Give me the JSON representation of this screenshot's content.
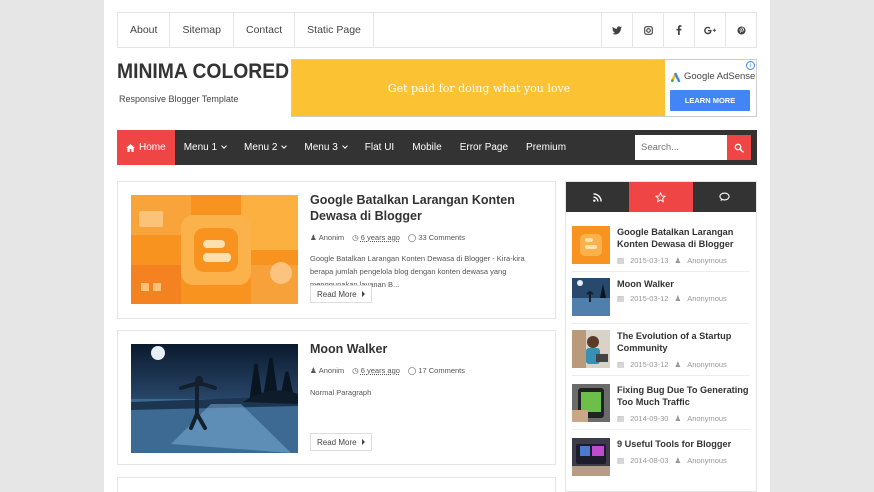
{
  "top_nav": [
    "About",
    "Sitemap",
    "Contact",
    "Static Page"
  ],
  "social": [
    {
      "name": "twitter-icon",
      "glyph": "t"
    },
    {
      "name": "instagram-icon",
      "glyph": "◘"
    },
    {
      "name": "facebook-icon",
      "glyph": "f"
    },
    {
      "name": "google-plus-icon",
      "glyph": "g+"
    },
    {
      "name": "pinterest-icon",
      "glyph": "℗"
    }
  ],
  "header": {
    "title": "MINIMA COLORED",
    "tagline": "Responsive Blogger Template"
  },
  "ad": {
    "text": "Get paid for doing what you love",
    "brand": "Google AdSense",
    "button": "LEARN MORE",
    "info": "i"
  },
  "main_nav": {
    "home": "Home",
    "items": [
      "Menu 1",
      "Menu 2",
      "Menu 3",
      "Flat UI",
      "Mobile",
      "Error Page",
      "Premium"
    ],
    "search_placeholder": "Search..."
  },
  "posts": [
    {
      "title": "Google Batalkan Larangan Konten Dewasa di Blogger",
      "author": "Anonim",
      "time": "6 years ago",
      "comments": "33 Comments",
      "snippet": "Google Batalkan Larangan Konten Dewasa di Blogger - Kira-kira berapa jumlah pengelola blog dengan konten dewasa yang menggunakan layanan B...",
      "read_more": "Read More"
    },
    {
      "title": "Moon Walker",
      "author": "Anonim",
      "time": "6 years ago",
      "comments": "17 Comments",
      "snippet": "Normal Paragraph",
      "read_more": "Read More"
    }
  ],
  "sidebar": {
    "tabs": [
      {
        "icon": "rss-icon",
        "glyph": "◥",
        "color": "#333333"
      },
      {
        "icon": "star-icon",
        "glyph": "☆",
        "color": "#f04545"
      },
      {
        "icon": "comments-icon",
        "glyph": "◉",
        "color": "#333333"
      }
    ],
    "items": [
      {
        "title": "Google Batalkan Larangan Konten Dewasa di Blogger",
        "date": "2015-03-13",
        "author": "Anonymous"
      },
      {
        "title": "Moon Walker",
        "date": "2015-03-12",
        "author": "Anonymous"
      },
      {
        "title": "The Evolution of a Startup Community",
        "date": "2015-03-12",
        "author": "Anonymous"
      },
      {
        "title": "Fixing Bug Due To Generating Too Much Traffic",
        "date": "2014-09-30",
        "author": "Anonymous"
      },
      {
        "title": "9 Useful Tools for Blogger",
        "date": "2014-08-03",
        "author": "Anonymous"
      }
    ]
  },
  "colors": {
    "accent": "#f04545",
    "nav_bg": "#333333",
    "ad_bg": "#fbc334",
    "adsense_button": "#4285f4"
  }
}
